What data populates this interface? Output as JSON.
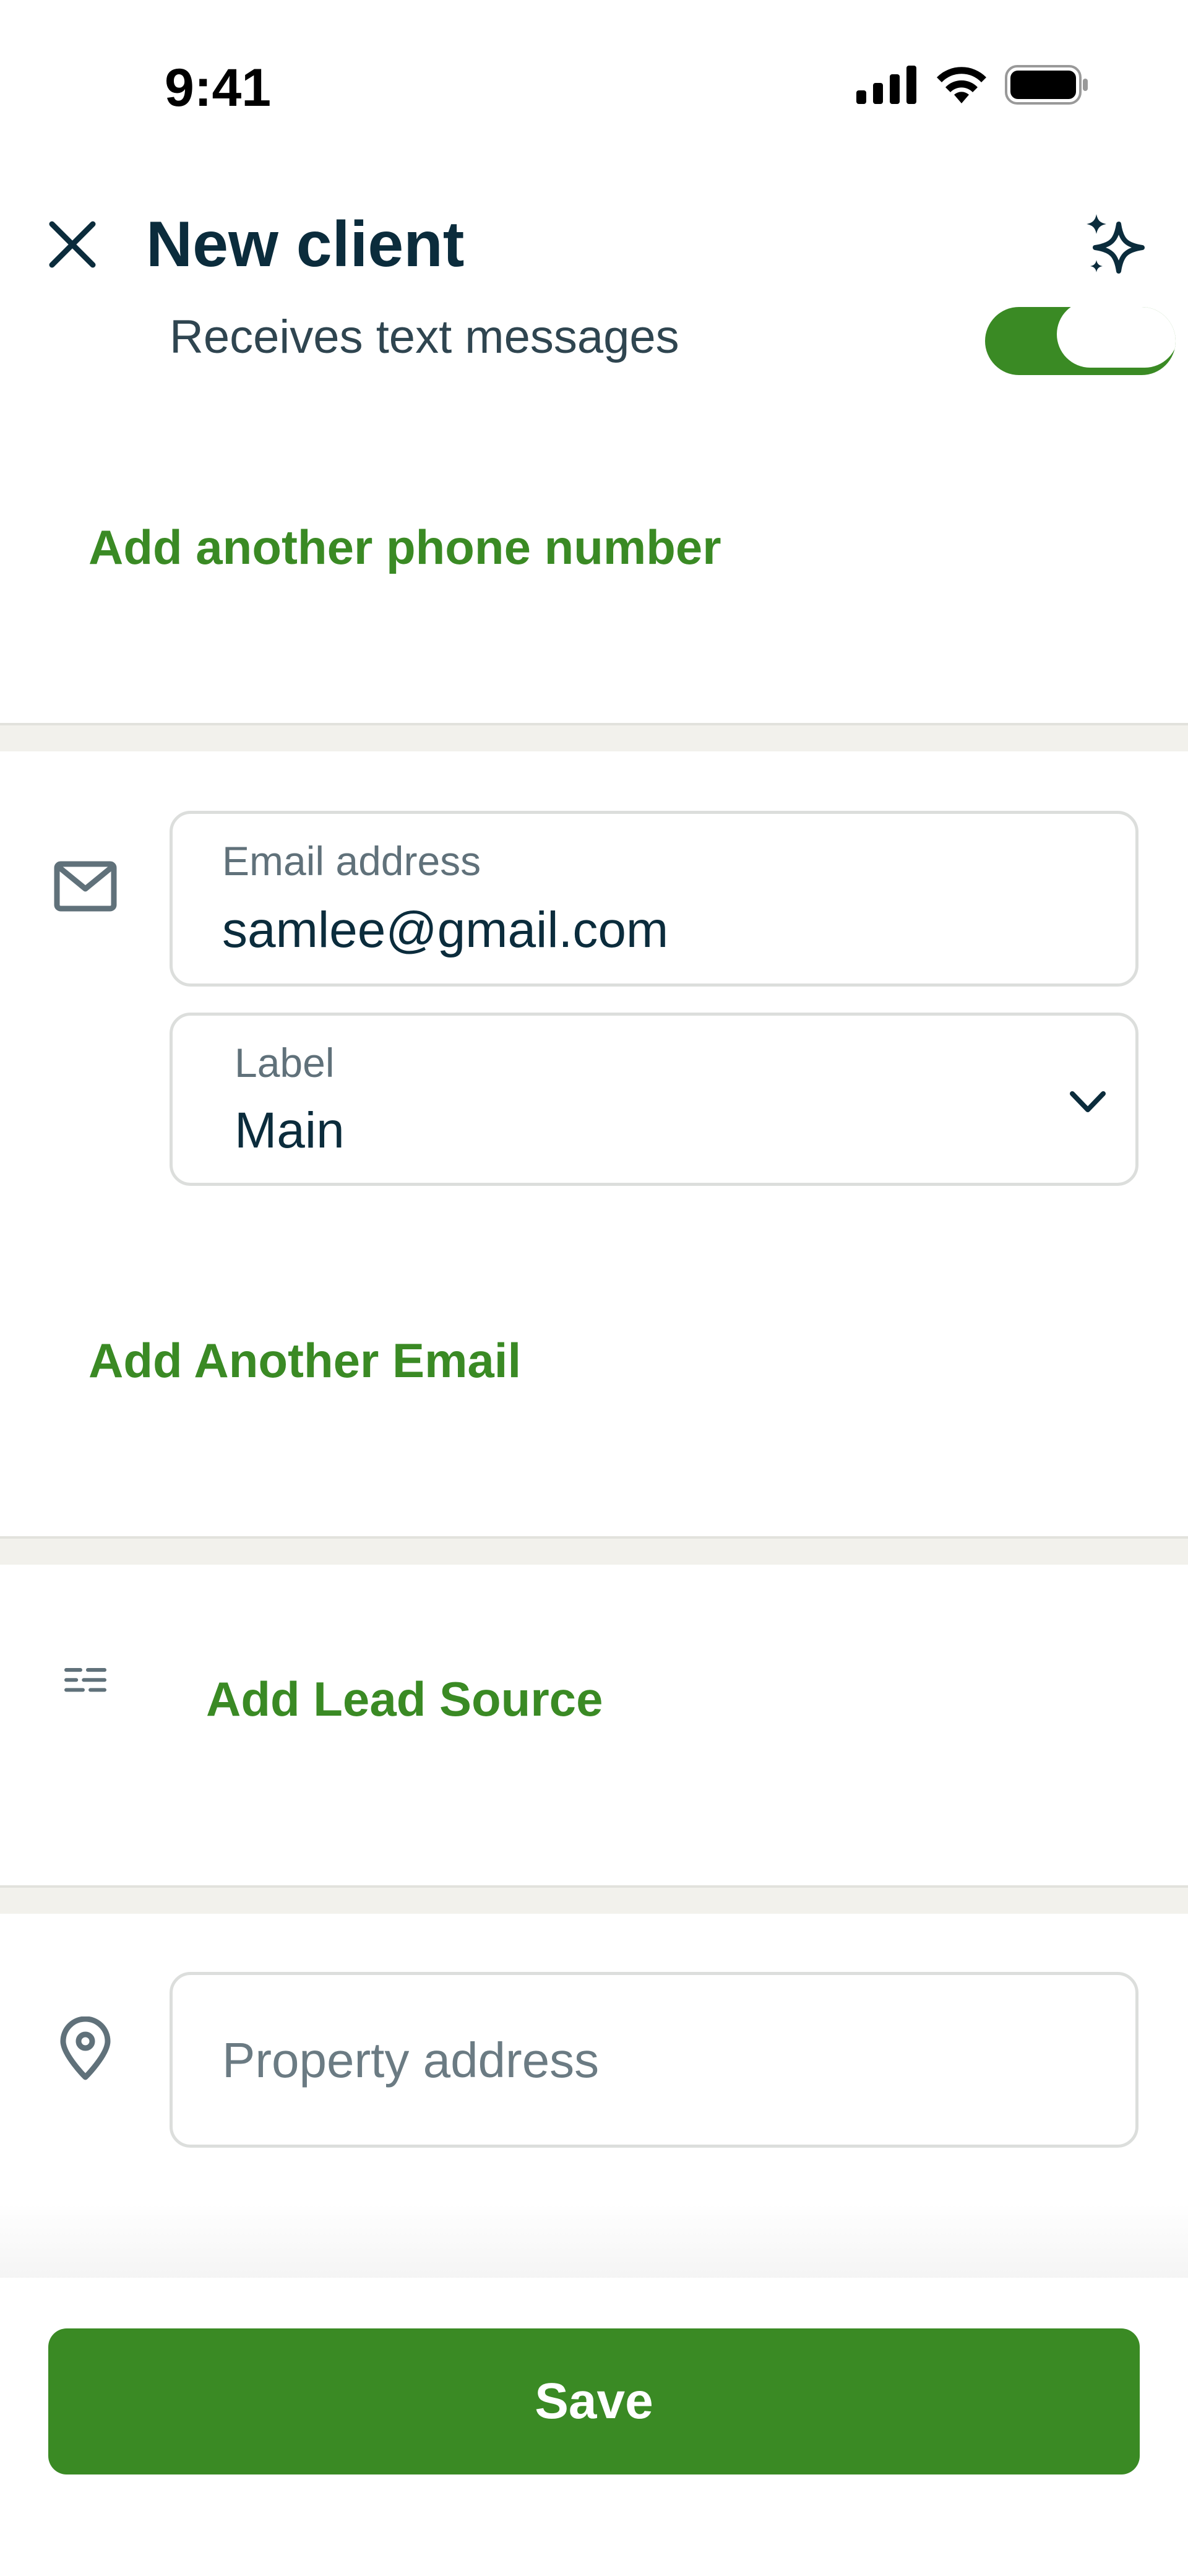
{
  "status_bar": {
    "time": "9:41"
  },
  "header": {
    "title": "New client"
  },
  "phone_section": {
    "sms_label": "Receives text messages",
    "sms_enabled": true,
    "add_phone_label": "Add another phone number"
  },
  "email_section": {
    "email_field_label": "Email address",
    "email_value": "samlee@gmail.com",
    "label_field_label": "Label",
    "label_value": "Main",
    "add_email_label": "Add Another Email"
  },
  "lead_source": {
    "label": "Add Lead Source"
  },
  "property": {
    "placeholder": "Property address"
  },
  "footer": {
    "save_label": "Save"
  },
  "colors": {
    "accent": "#3a8a24",
    "title": "#0b2c3c",
    "divider": "#f2f1ec"
  },
  "icons": [
    "close-icon",
    "sparkle-icon",
    "mail-icon",
    "chevron-down-icon",
    "lead-source-icon",
    "location-pin-icon",
    "signal-icon",
    "wifi-icon",
    "battery-icon"
  ]
}
